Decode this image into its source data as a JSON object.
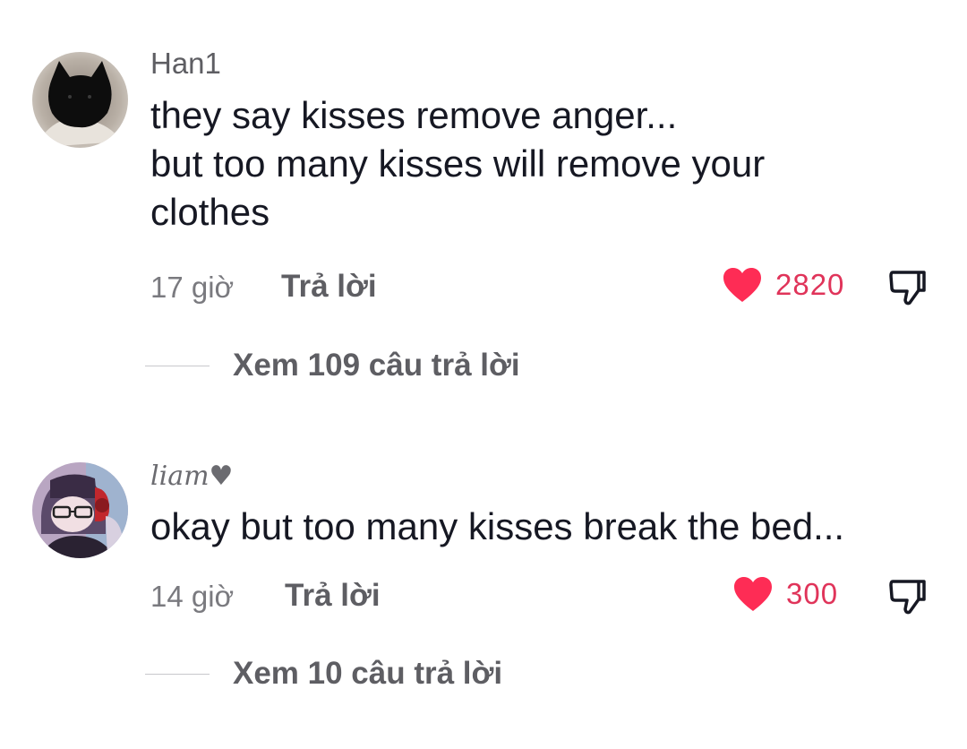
{
  "comments": [
    {
      "username": "Han1",
      "text_lines": [
        "they say kisses remove anger...",
        "but too many kisses will remove your",
        "clothes"
      ],
      "time": "17 giờ",
      "reply_label": "Trả lời",
      "like_count": "2820",
      "view_replies_label": "Xem 109 câu trả lời",
      "avatar_icon": "black-cat-avatar"
    },
    {
      "username": "liam♥",
      "text_lines": [
        "okay but too many kisses break the bed..."
      ],
      "time": "14 giờ",
      "reply_label": "Trả lời",
      "like_count": "300",
      "view_replies_label": "Xem 10 câu trả lời",
      "avatar_icon": "anime-character-avatar"
    }
  ],
  "colors": {
    "like_red": "#fe2c55",
    "like_count": "#e0345a",
    "muted_text": "#5e5e63",
    "body_text": "#161823"
  },
  "icons": {
    "like": "heart-icon",
    "dislike": "thumbs-down-icon"
  }
}
